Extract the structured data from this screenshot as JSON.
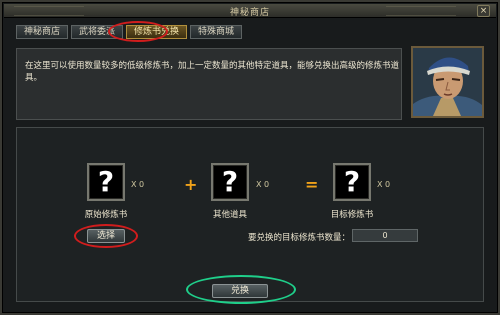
{
  "window": {
    "title": "神秘商店",
    "close_glyph": "×"
  },
  "tabs": [
    {
      "label": "神秘商店"
    },
    {
      "label": "武将委派"
    },
    {
      "label": "修炼书兑换"
    },
    {
      "label": "特殊商城"
    }
  ],
  "description": "在这里可以使用数量较多的低级修炼书，加上一定数量的其他特定道具，能够兑换出高级的修炼书道具。",
  "slots": [
    {
      "glyph": "?",
      "count": "X 0",
      "label": "原始修炼书"
    },
    {
      "glyph": "?",
      "count": "X 0",
      "label": "其他道具"
    },
    {
      "glyph": "?",
      "count": "X 0",
      "label": "目标修炼书"
    }
  ],
  "operators": {
    "plus": "+",
    "equals": "="
  },
  "select_button": "选择",
  "target_label": "要兑换的目标修炼书数量：",
  "target_value": "0",
  "exchange_button": "兑换",
  "colors": {
    "red_highlight": "#d11d1d",
    "green_highlight": "#1fcf8a",
    "operator": "#f0a21a"
  }
}
